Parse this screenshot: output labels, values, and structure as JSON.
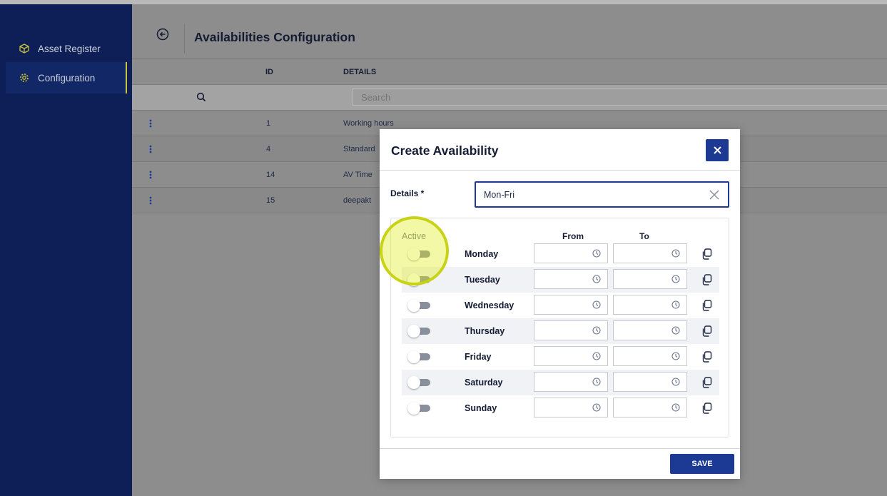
{
  "sidebar": {
    "items": [
      {
        "label": "Asset Register",
        "icon": "cube-icon"
      },
      {
        "label": "Configuration",
        "icon": "gear-icon",
        "active": true
      }
    ]
  },
  "page": {
    "title": "Availabilities Configuration"
  },
  "table": {
    "headers": {
      "id": "ID",
      "details": "DETAILS"
    },
    "search_placeholder": "Search",
    "rows": [
      {
        "id": "1",
        "details": "Working hours"
      },
      {
        "id": "4",
        "details": "Standard"
      },
      {
        "id": "14",
        "details": "AV Time"
      },
      {
        "id": "15",
        "details": "deepakt"
      }
    ]
  },
  "modal": {
    "title": "Create Availability",
    "details_label": "Details *",
    "details_value": "Mon-Fri",
    "col_active": "Active",
    "col_from": "From",
    "col_to": "To",
    "days": [
      {
        "name": "Monday",
        "active": false
      },
      {
        "name": "Tuesday",
        "active": false
      },
      {
        "name": "Wednesday",
        "active": false
      },
      {
        "name": "Thursday",
        "active": false
      },
      {
        "name": "Friday",
        "active": false
      },
      {
        "name": "Saturday",
        "active": false
      },
      {
        "name": "Sunday",
        "active": false
      }
    ],
    "save_label": "SAVE"
  },
  "colors": {
    "sidebar": "#0d1f56",
    "accent": "#1c3a94",
    "highlight": "#c9d316"
  }
}
